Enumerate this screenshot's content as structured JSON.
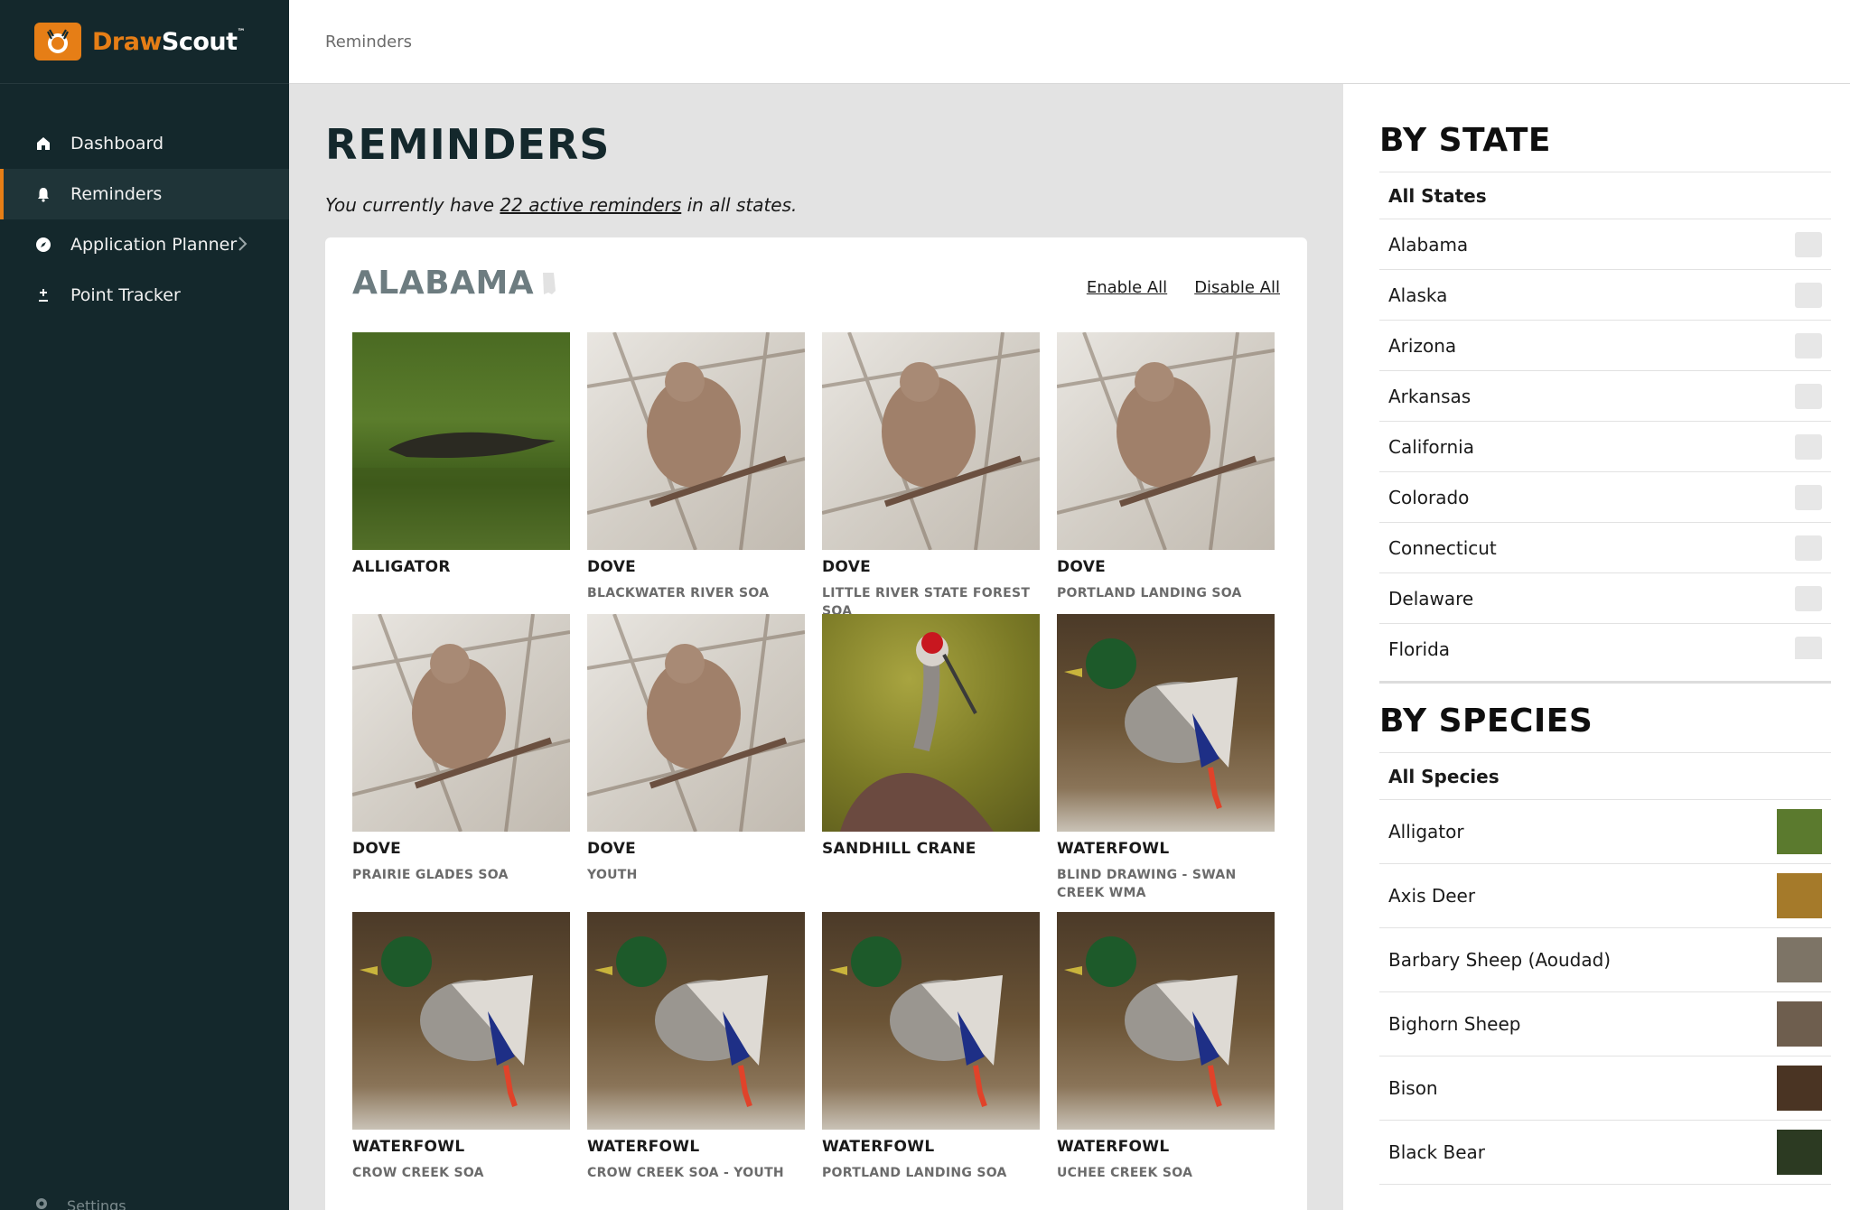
{
  "app": {
    "logo_part1": "Draw",
    "logo_part2": "Scout",
    "logo_tm": "™"
  },
  "nav": {
    "items": [
      {
        "label": "Dashboard",
        "icon": "home-icon"
      },
      {
        "label": "Reminders",
        "icon": "bell-icon",
        "active": true
      },
      {
        "label": "Application Planner",
        "icon": "compass-icon"
      },
      {
        "label": "Point Tracker",
        "icon": "plus-minus-icon"
      }
    ],
    "settings_label": "Settings"
  },
  "breadcrumb": "Reminders",
  "page": {
    "title": "REMINDERS",
    "summary_prefix": "You currently have ",
    "summary_link": "22 active reminders",
    "summary_suffix": " in all states."
  },
  "state_card": {
    "name": "ALABAMA",
    "enable_all": "Enable All",
    "disable_all": "Disable All",
    "tiles": [
      {
        "title": "ALLIGATOR",
        "sub": "",
        "photo": "gator"
      },
      {
        "title": "DOVE",
        "sub": "BLACKWATER RIVER SOA",
        "photo": "dove"
      },
      {
        "title": "DOVE",
        "sub": "LITTLE RIVER STATE FOREST SOA",
        "photo": "dove"
      },
      {
        "title": "DOVE",
        "sub": "PORTLAND LANDING SOA",
        "photo": "dove"
      },
      {
        "title": "DOVE",
        "sub": "PRAIRIE GLADES SOA",
        "photo": "dove"
      },
      {
        "title": "DOVE",
        "sub": "YOUTH",
        "photo": "dove"
      },
      {
        "title": "SANDHILL CRANE",
        "sub": "",
        "photo": "crane"
      },
      {
        "title": "WATERFOWL",
        "sub": "BLIND DRAWING - SWAN CREEK WMA",
        "photo": "duck"
      },
      {
        "title": "WATERFOWL",
        "sub": "CROW CREEK SOA",
        "photo": "duck"
      },
      {
        "title": "WATERFOWL",
        "sub": "CROW CREEK SOA - YOUTH",
        "photo": "duck"
      },
      {
        "title": "WATERFOWL",
        "sub": "PORTLAND LANDING SOA",
        "photo": "duck"
      },
      {
        "title": "WATERFOWL",
        "sub": "UCHEE CREEK SOA",
        "photo": "duck"
      }
    ]
  },
  "by_state": {
    "heading": "BY STATE",
    "all_label": "All States",
    "states": [
      "Alabama",
      "Alaska",
      "Arizona",
      "Arkansas",
      "California",
      "Colorado",
      "Connecticut",
      "Delaware",
      "Florida"
    ]
  },
  "by_species": {
    "heading": "BY SPECIES",
    "all_label": "All Species",
    "species": [
      {
        "label": "Alligator",
        "thumb_color": "#5b7a2e"
      },
      {
        "label": "Axis Deer",
        "thumb_color": "#a57a2a"
      },
      {
        "label": "Barbary Sheep (Aoudad)",
        "thumb_color": "#7d7466"
      },
      {
        "label": "Bighorn Sheep",
        "thumb_color": "#6e5e4e"
      },
      {
        "label": "Bison",
        "thumb_color": "#4a3423"
      },
      {
        "label": "Black Bear",
        "thumb_color": "#2c3a22"
      }
    ]
  },
  "colors": {
    "accent": "#e67e16",
    "sidebar_bg": "#14282c"
  }
}
